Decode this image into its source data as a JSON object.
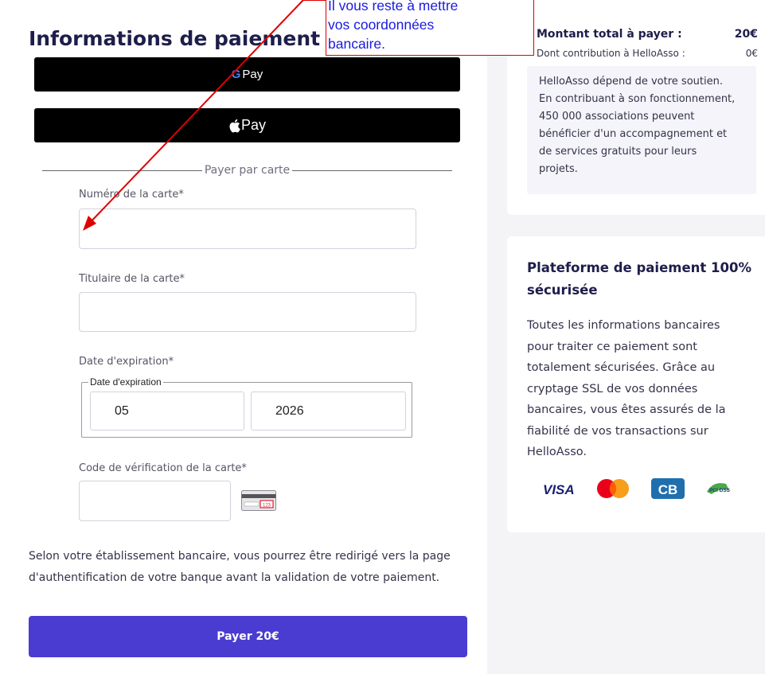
{
  "payment": {
    "title": "Informations de paiement",
    "gpay_g": "G",
    "gpay_label": "Pay",
    "apple_pay_label": "Pay",
    "divider": "Payer par carte",
    "card_number_label": "Numéro de la carte*",
    "card_holder_label": "Titulaire de la carte*",
    "expiry_label": "Date d'expiration*",
    "expiry_legend": "Date d'expiration",
    "expiry_month": "05",
    "expiry_year": "2026",
    "cvv_label": "Code de vérification de la carte*",
    "cvv_card_digits": "123",
    "note_line1": "Selon votre établissement bancaire, vous pourrez être redirigé vers la page",
    "note_line2": "d'authentification de votre banque avant la validation de votre paiement.",
    "pay_button": "Payer 20€"
  },
  "summary": {
    "total_label": "Montant total à payer :",
    "total_value": "20€",
    "contribution_label": "Dont contribution à HelloAsso :",
    "contribution_value": "0€",
    "support_lines": [
      "HelloAsso dépend de votre soutien.",
      "En contribuant à son fonctionnement,",
      "450 000 associations peuvent",
      "bénéficier d'un accompagnement et",
      "de services gratuits pour leurs",
      "projets."
    ]
  },
  "secure": {
    "title_line1": "Plateforme de paiement 100%",
    "title_line2": "sécurisée",
    "text_lines": [
      "Toutes les informations bancaires",
      "pour traiter ce paiement sont",
      "totalement sécurisées. Grâce au",
      "cryptage SSL de vos données",
      "bancaires, vous êtes assurés de la",
      "fiabilité de vos transactions sur",
      "HelloAsso."
    ],
    "logos": {
      "visa": "VISA",
      "cb": "CB",
      "pci": "PCI DSS"
    },
    "colors": {
      "visa": "#1a1f71",
      "mastercard_red": "#eb001b",
      "mastercard_orange": "#f79e1b",
      "cb_blue": "#1f6fae"
    }
  },
  "annotation": {
    "line1": "Il vous reste à mettre",
    "line2": "vos coordonnées",
    "line3": "bancaire."
  },
  "colors": {
    "title": "#1e1e4b",
    "pay_button": "#4a3cd1",
    "annotation_border": "#e00000",
    "annotation_text": "#1a1ae0",
    "arrow": "#e00000"
  }
}
